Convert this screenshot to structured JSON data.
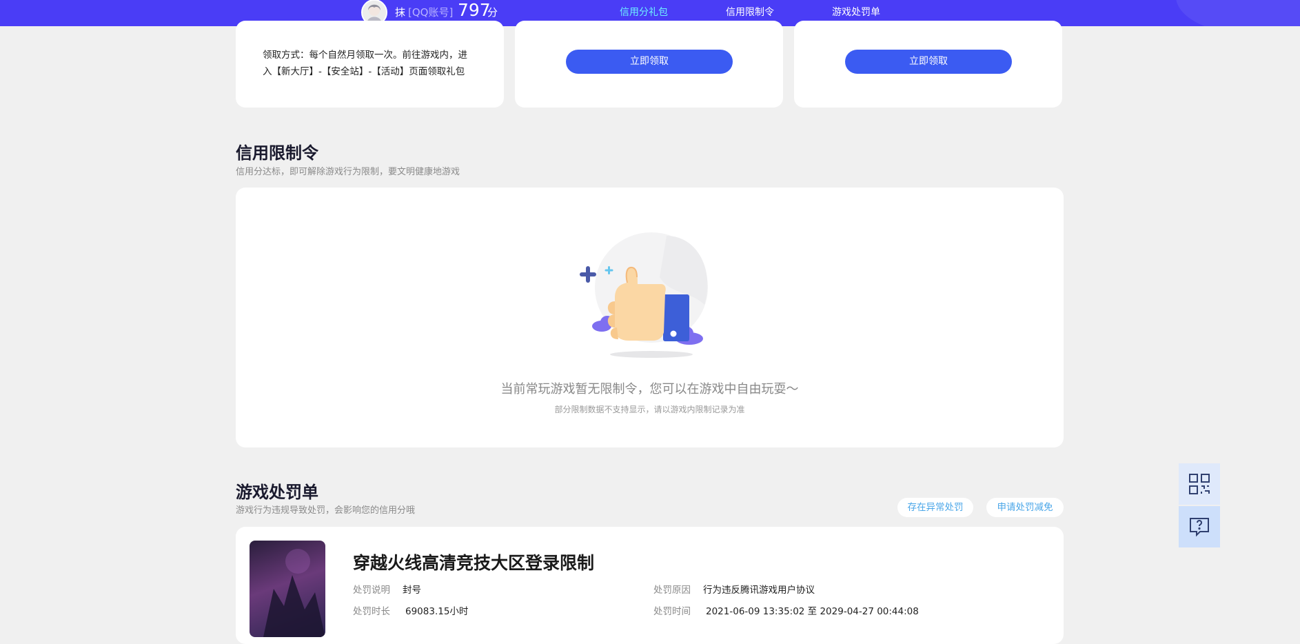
{
  "header": {
    "user_name": "抹",
    "account_type": "[QQ账号]",
    "score": "797",
    "score_unit": "分",
    "tabs": [
      {
        "label": "信用分礼包",
        "active": true
      },
      {
        "label": "信用限制令",
        "active": false
      },
      {
        "label": "游戏处罚单",
        "active": false
      }
    ]
  },
  "gift_cards": {
    "claim_method_line1": "领取方式：每个自然月领取一次。前往游戏内，进",
    "claim_method_line2": "入【新大厅】-【安全站】-【活动】页面领取礼包",
    "claim_button_1": "立即领取",
    "claim_button_2": "立即领取"
  },
  "restriction": {
    "title": "信用限制令",
    "subtitle": "信用分达标，即可解除游戏行为限制，要文明健康地游戏",
    "empty_message": "当前常玩游戏暂无限制令，您可以在游戏中自由玩耍～",
    "empty_note": "部分限制数据不支持显示，请以游戏内限制记录为准"
  },
  "penalty": {
    "title": "游戏处罚单",
    "subtitle": "游戏行为违规导致处罚，会影响您的信用分哦",
    "report_abnormal": "存在异常处罚",
    "apply_reduction": "申请处罚减免",
    "item": {
      "game_title": "穿越火线高清竞技大区登录限制",
      "desc_label": "处罚说明",
      "desc_value": "封号",
      "reason_label": "处罚原因",
      "reason_value": "行为违反腾讯游戏用户协议",
      "duration_label": "处罚时长",
      "duration_value": "69083.15小时",
      "time_label": "处罚时间",
      "time_value": "2021-06-09 13:35:02 至 2029-04-27 00:44:08"
    }
  },
  "floating": {
    "qr_icon": "qr-code-icon",
    "help_icon": "help-chat-icon"
  },
  "colors": {
    "header_bg": "#4a3df6",
    "active_tab": "#6ef0ff",
    "button_blue": "#3b5bf2",
    "pill_text": "#4aa6e8"
  }
}
